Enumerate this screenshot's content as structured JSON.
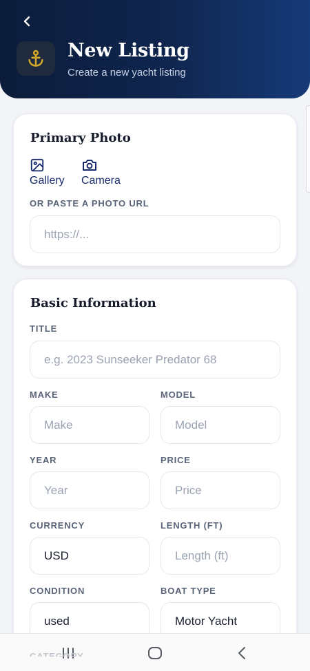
{
  "header": {
    "title": "New Listing",
    "subtitle": "Create a new yacht listing",
    "back_icon": "chevron-left-icon",
    "logo_icon": "anchor-icon",
    "colors": {
      "gradient_start": "#0b1c3b",
      "gradient_end": "#163a78",
      "anchor": "#d4a82a"
    }
  },
  "primary_photo": {
    "title": "Primary Photo",
    "gallery_label": "Gallery",
    "camera_label": "Camera",
    "url_label": "OR PASTE A PHOTO URL",
    "url_placeholder": "https://..."
  },
  "basic_info": {
    "title": "Basic Information",
    "title_label": "TITLE",
    "title_placeholder": "e.g. 2023 Sunseeker Predator 68",
    "make_label": "MAKE",
    "make_placeholder": "Make",
    "model_label": "MODEL",
    "model_placeholder": "Model",
    "year_label": "YEAR",
    "year_placeholder": "Year",
    "price_label": "PRICE",
    "price_placeholder": "Price",
    "currency_label": "CURRENCY",
    "currency_value": "USD",
    "length_label": "LENGTH (FT)",
    "length_placeholder": "Length (ft)",
    "condition_label": "CONDITION",
    "condition_value": "used",
    "boat_type_label": "BOAT TYPE",
    "boat_type_value": "Motor Yacht",
    "category_label": "CATEGORY"
  },
  "system_nav": {
    "recents_icon": "recent-apps-icon",
    "home_icon": "home-icon",
    "back_icon": "system-back-icon"
  }
}
